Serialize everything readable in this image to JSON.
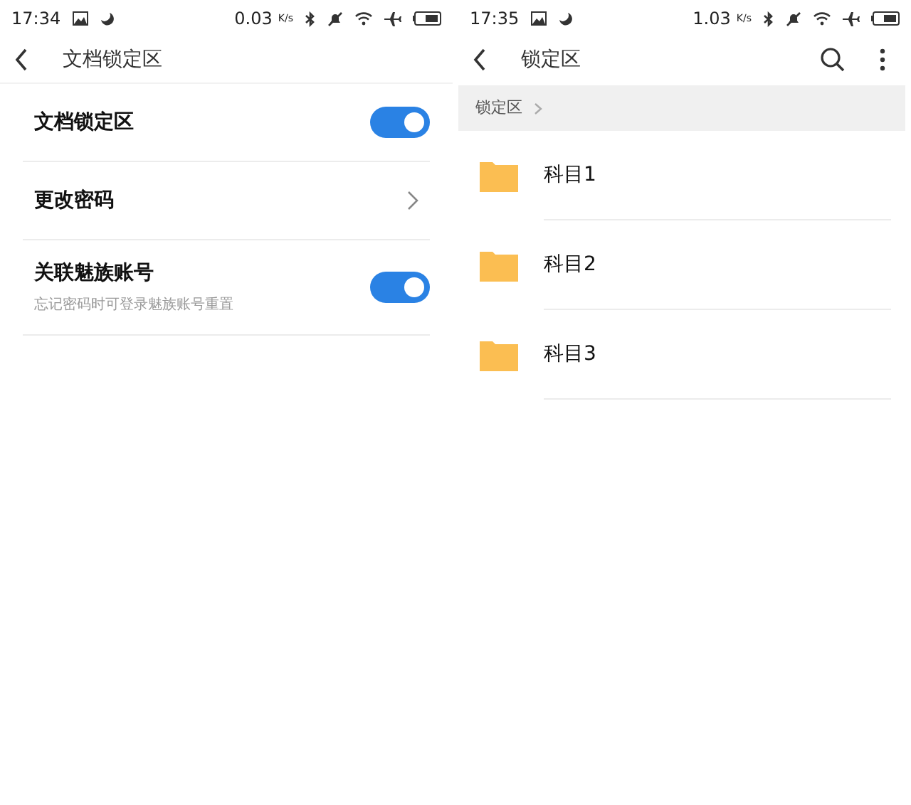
{
  "settings_screen": {
    "status_bar": {
      "time": "17:34",
      "speed": "0.03",
      "speed_unit": "K/s"
    },
    "toolbar": {
      "title": "文档锁定区"
    },
    "items": [
      {
        "kind": "switch",
        "title": "文档锁定区",
        "on": true
      },
      {
        "kind": "link",
        "title": "更改密码"
      },
      {
        "kind": "switch",
        "title": "关联魅族账号",
        "subtitle": "忘记密码时可登录魅族账号重置",
        "on": true
      }
    ]
  },
  "folder_screen": {
    "status_bar": {
      "time": "17:35",
      "speed": "1.03",
      "speed_unit": "K/s"
    },
    "toolbar": {
      "title": "锁定区"
    },
    "breadcrumb": [
      "锁定区"
    ],
    "folders": [
      {
        "name": "科目1"
      },
      {
        "name": "科目2"
      },
      {
        "name": "科目3"
      }
    ]
  }
}
